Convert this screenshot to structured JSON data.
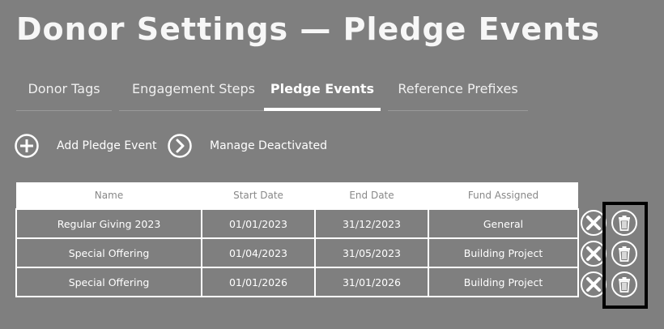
{
  "page": {
    "title": "Donor Settings — Pledge Events"
  },
  "tabs": [
    {
      "label": "Donor Tags"
    },
    {
      "label": "Engagement Steps"
    },
    {
      "label": "Pledge Events"
    },
    {
      "label": "Reference Prefixes"
    }
  ],
  "actions": {
    "add_label": "Add Pledge Event",
    "manage_label": "Manage Deactivated"
  },
  "table": {
    "headers": [
      "Name",
      "Start Date",
      "End Date",
      "Fund Assigned"
    ],
    "rows": [
      [
        "Regular Giving 2023",
        "01/01/2023",
        "31/12/2023",
        "General"
      ],
      [
        "Special Offering",
        "01/04/2023",
        "31/05/2023",
        "Building Project"
      ],
      [
        "Special Offering",
        "01/01/2026",
        "31/01/2026",
        "Building Project"
      ]
    ]
  },
  "icons": {
    "add": "plus-circle-icon",
    "manage": "chevron-right-circle-icon",
    "deactivate": "x-circle-icon",
    "delete": "trash-icon"
  },
  "colors": {
    "background": "#7f7f7f",
    "highlight": "#000000"
  }
}
